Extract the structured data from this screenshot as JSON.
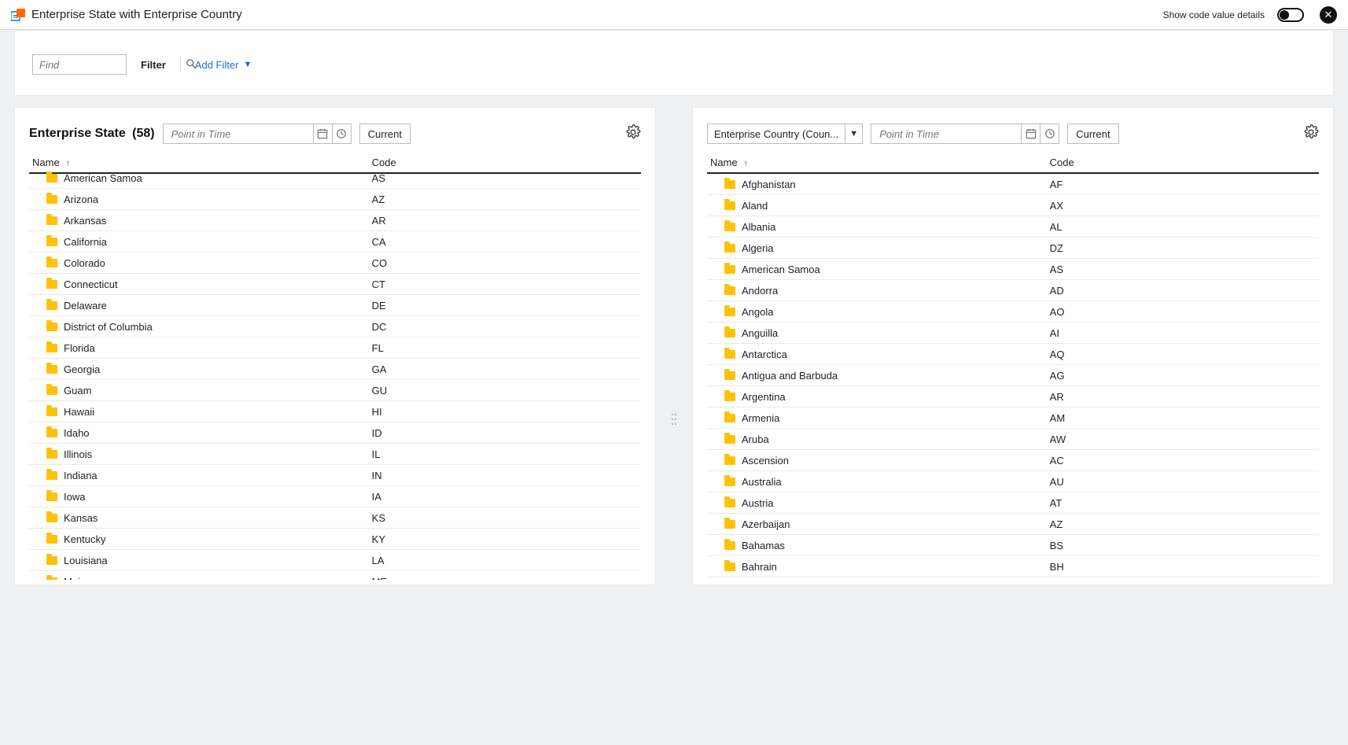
{
  "header": {
    "title": "Enterprise State with Enterprise Country",
    "toggle_label": "Show code value details",
    "close_icon_label": "✕"
  },
  "filter": {
    "find_placeholder": "Find",
    "label": "Filter",
    "add_filter_label": "Add Filter"
  },
  "left_panel": {
    "title": "Enterprise State",
    "count": "(58)",
    "point_in_time_placeholder": "Point in Time",
    "current_label": "Current",
    "columns": {
      "name": "Name",
      "code": "Code"
    },
    "rows": [
      {
        "name": "American Samoa",
        "code": "AS"
      },
      {
        "name": "Arizona",
        "code": "AZ"
      },
      {
        "name": "Arkansas",
        "code": "AR"
      },
      {
        "name": "California",
        "code": "CA"
      },
      {
        "name": "Colorado",
        "code": "CO"
      },
      {
        "name": "Connecticut",
        "code": "CT"
      },
      {
        "name": "Delaware",
        "code": "DE"
      },
      {
        "name": "District of Columbia",
        "code": "DC"
      },
      {
        "name": "Florida",
        "code": "FL"
      },
      {
        "name": "Georgia",
        "code": "GA"
      },
      {
        "name": "Guam",
        "code": "GU"
      },
      {
        "name": "Hawaii",
        "code": "HI"
      },
      {
        "name": "Idaho",
        "code": "ID"
      },
      {
        "name": "Illinois",
        "code": "IL"
      },
      {
        "name": "Indiana",
        "code": "IN"
      },
      {
        "name": "Iowa",
        "code": "IA"
      },
      {
        "name": "Kansas",
        "code": "KS"
      },
      {
        "name": "Kentucky",
        "code": "KY"
      },
      {
        "name": "Louisiana",
        "code": "LA"
      },
      {
        "name": "Maine",
        "code": "ME"
      }
    ]
  },
  "right_panel": {
    "dropdown_label": "Enterprise Country (Coun...",
    "point_in_time_placeholder": "Point in Time",
    "current_label": "Current",
    "columns": {
      "name": "Name",
      "code": "Code"
    },
    "rows": [
      {
        "name": "Afghanistan",
        "code": "AF"
      },
      {
        "name": "Aland",
        "code": "AX"
      },
      {
        "name": "Albania",
        "code": "AL"
      },
      {
        "name": "Algeria",
        "code": "DZ"
      },
      {
        "name": "American Samoa",
        "code": "AS"
      },
      {
        "name": "Andorra",
        "code": "AD"
      },
      {
        "name": "Angola",
        "code": "AO"
      },
      {
        "name": "Anguilla",
        "code": "AI"
      },
      {
        "name": "Antarctica",
        "code": "AQ"
      },
      {
        "name": "Antigua and Barbuda",
        "code": "AG"
      },
      {
        "name": "Argentina",
        "code": "AR"
      },
      {
        "name": "Armenia",
        "code": "AM"
      },
      {
        "name": "Aruba",
        "code": "AW"
      },
      {
        "name": "Ascension",
        "code": "AC"
      },
      {
        "name": "Australia",
        "code": "AU"
      },
      {
        "name": "Austria",
        "code": "AT"
      },
      {
        "name": "Azerbaijan",
        "code": "AZ"
      },
      {
        "name": "Bahamas",
        "code": "BS"
      },
      {
        "name": "Bahrain",
        "code": "BH"
      }
    ]
  },
  "icons": {
    "calendar": "📅",
    "clock": "🕓",
    "gear": "⚙",
    "search": "🔍",
    "dots": "⋮⋮"
  }
}
